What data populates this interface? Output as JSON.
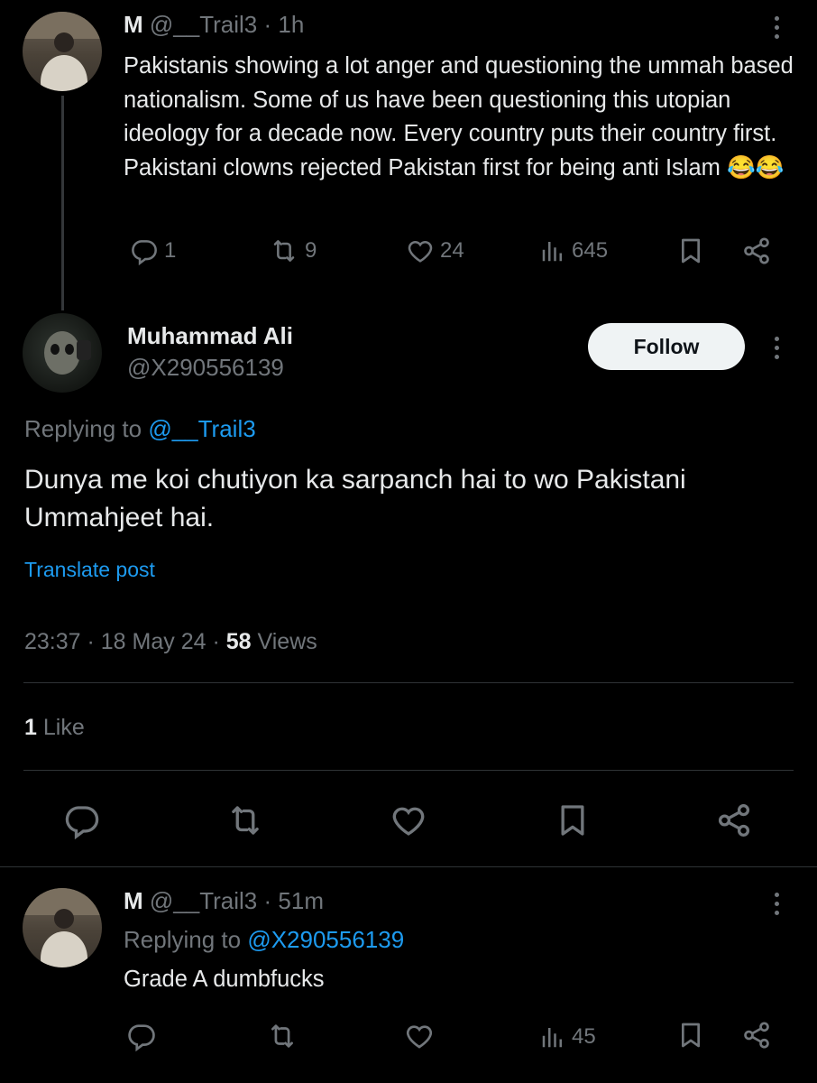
{
  "parent_tweet": {
    "display_name": "M",
    "handle": "@__Trail3",
    "time": "· 1h",
    "text": "Pakistanis showing a lot anger and questioning the ummah based nationalism. Some of us have been questioning this utopian ideology for a decade now. Every country puts their country first. Pakistani clowns rejected Pakistan first for being anti Islam 😂😂",
    "replies": "1",
    "reposts": "9",
    "likes": "24",
    "views": "645"
  },
  "main_tweet": {
    "display_name": "Muhammad Ali",
    "handle": "@X290556139",
    "follow_label": "Follow",
    "replying_prefix": "Replying to",
    "replying_handle": "@__Trail3",
    "text": "Dunya me koi chutiyon ka sarpanch hai to wo Pakistani Ummahjeet hai.",
    "translate_label": "Translate post",
    "timestamp": "23:37 · 18 May 24 ·",
    "views_count": "58",
    "views_label": "Views",
    "likes_count": "1",
    "likes_label": "Like"
  },
  "reply_tweet": {
    "display_name": "M",
    "handle": "@__Trail3",
    "time": "· 51m",
    "replying_prefix": "Replying to",
    "replying_handle": "@X290556139",
    "text": "Grade A dumbfucks",
    "views": "45"
  },
  "colors": {
    "background": "#000000",
    "text": "#e7e9ea",
    "muted": "#71767b",
    "link": "#1d9bf0",
    "divider": "#2f3336"
  }
}
